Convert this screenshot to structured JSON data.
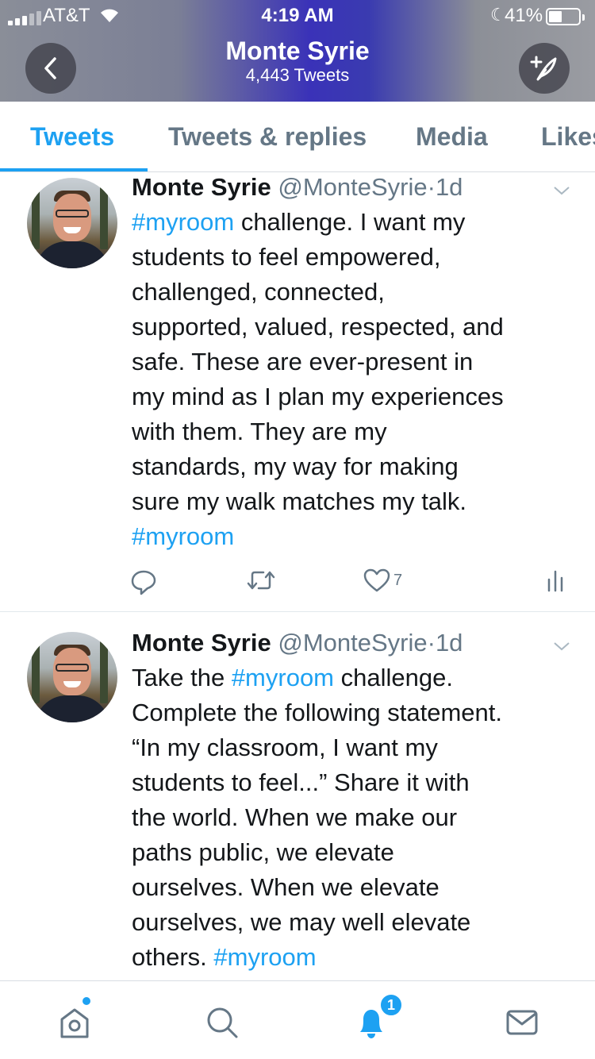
{
  "status_bar": {
    "carrier": "AT&T",
    "time": "4:19 AM",
    "battery_percent": "41%",
    "battery_level": 0.41
  },
  "profile_header": {
    "name": "Monte Syrie",
    "tweet_count": "4,443 Tweets",
    "back_icon": "chevron-left-icon",
    "compose_icon": "compose-feather-icon"
  },
  "tabs": [
    {
      "label": "Tweets",
      "active": true
    },
    {
      "label": "Tweets & replies",
      "active": false
    },
    {
      "label": "Media",
      "active": false
    },
    {
      "label": "Likes",
      "active": false
    }
  ],
  "tweets": [
    {
      "name": "Monte Syrie",
      "handle": "@MonteSyrie",
      "separator": "·",
      "time": "1d",
      "lines": [
        [
          {
            "t": "#myroom",
            "tag": true
          },
          {
            "t": " challenge. I want my",
            "tag": false
          }
        ],
        [
          {
            "t": "students to feel empowered,",
            "tag": false
          }
        ],
        [
          {
            "t": "challenged, connected,",
            "tag": false
          }
        ],
        [
          {
            "t": "supported, valued, respected, and",
            "tag": false
          }
        ],
        [
          {
            "t": "safe. These are ever-present in",
            "tag": false
          }
        ],
        [
          {
            "t": "my mind as I plan my experiences",
            "tag": false
          }
        ],
        [
          {
            "t": "with them. They are my",
            "tag": false
          }
        ],
        [
          {
            "t": "standards, my way for making",
            "tag": false
          }
        ],
        [
          {
            "t": "sure my walk matches my talk.",
            "tag": false
          }
        ],
        [
          {
            "t": "#myroom",
            "tag": true
          }
        ]
      ],
      "like_count": "7"
    },
    {
      "name": "Monte Syrie",
      "handle": "@MonteSyrie",
      "separator": "·",
      "time": "1d",
      "lines": [
        [
          {
            "t": "Take the ",
            "tag": false
          },
          {
            "t": "#myroom",
            "tag": true
          },
          {
            "t": " challenge.",
            "tag": false
          }
        ],
        [
          {
            "t": "Complete the following statement.",
            "tag": false
          }
        ],
        [
          {
            "t": "“In my classroom, I want my",
            "tag": false
          }
        ],
        [
          {
            "t": "students to feel...” Share it with",
            "tag": false
          }
        ],
        [
          {
            "t": "the world. When we make our",
            "tag": false
          }
        ],
        [
          {
            "t": "paths public, we elevate",
            "tag": false
          }
        ],
        [
          {
            "t": "ourselves. When we elevate",
            "tag": false
          }
        ],
        [
          {
            "t": "ourselves, we may well elevate",
            "tag": false
          }
        ],
        [
          {
            "t": "others. ",
            "tag": false
          },
          {
            "t": "#myroom",
            "tag": true
          }
        ]
      ]
    }
  ],
  "bottom_nav": {
    "items": [
      "home-icon",
      "search-icon",
      "notifications-bell-icon",
      "messages-envelope-icon"
    ],
    "notification_badge": "1"
  },
  "colors": {
    "accent": "#1da1f2",
    "secondary_text": "#657786"
  }
}
